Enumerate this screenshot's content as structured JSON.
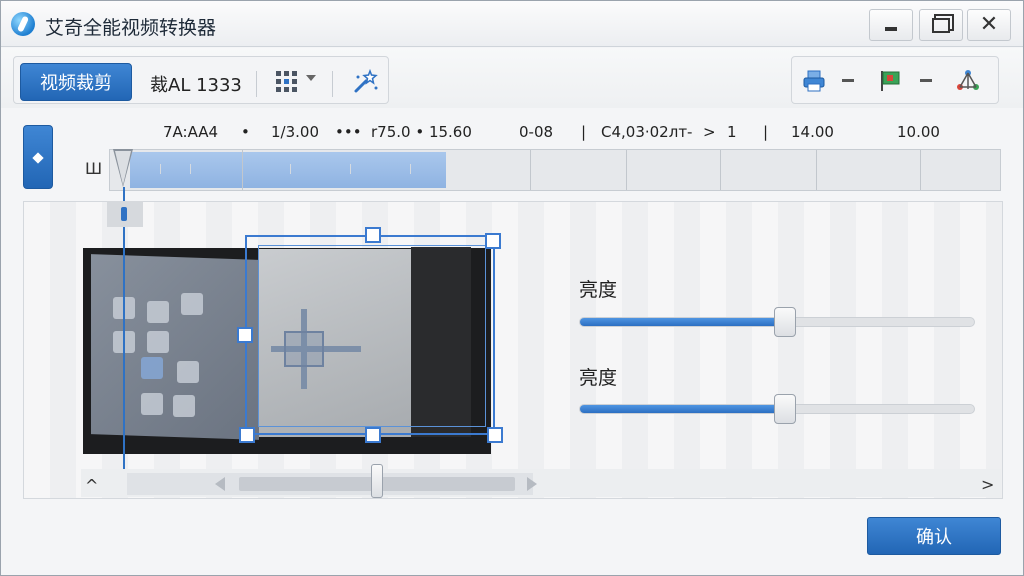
{
  "window": {
    "title": "艾奇全能视频转换器",
    "close_glyph": "✕"
  },
  "toolbar": {
    "primary_label": "视频裁剪",
    "crop_label": "裁AL 1333",
    "left_icons": [
      "grid-icon",
      "chevron-down-icon",
      "magic-wand-icon"
    ],
    "right_icons": [
      "printer-icon",
      "flag-icon",
      "network-icon"
    ]
  },
  "timeline": {
    "track_label": "Ш",
    "ruler": [
      "7A:AA4",
      "•",
      "1/3.00",
      "•••",
      "r75.0 • 15.60",
      "0-08",
      "|",
      "C4,03·02лт-",
      ">",
      "1",
      "|",
      "14.00",
      "10.00"
    ]
  },
  "adjustments": [
    {
      "label": "亮度",
      "value_percent": 52
    },
    {
      "label": "亮度",
      "value_percent": 52
    }
  ],
  "scroll": {
    "up_arrow": "^",
    "right_arrow": ">"
  },
  "footer": {
    "confirm_label": "确认"
  },
  "colors": {
    "accent": "#2a6fc4",
    "crop_frame": "#3b7ad0"
  }
}
